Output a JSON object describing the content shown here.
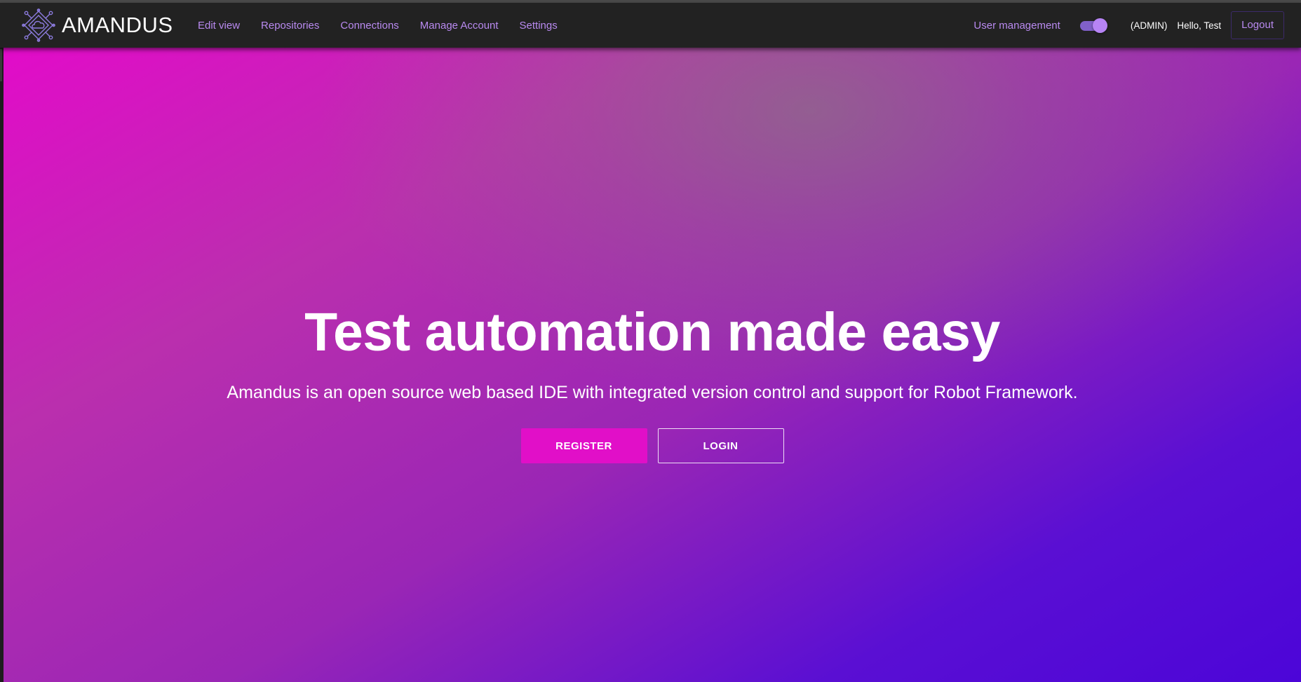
{
  "navbar": {
    "brand": "AMANDUS",
    "links": [
      "Edit view",
      "Repositories",
      "Connections",
      "Manage Account",
      "Settings"
    ],
    "user_management": "User management",
    "toggle_on": true,
    "role": "(ADMIN)",
    "greeting": "Hello, Test",
    "logout": "Logout"
  },
  "hero": {
    "title": "Test automation made easy",
    "subtitle": "Amandus is an open source web based IDE with integrated version control and support for Robot Framework.",
    "register_label": "REGISTER",
    "login_label": "LOGIN"
  },
  "colors": {
    "navbar_bg": "#222222",
    "link": "#b98af0",
    "accent": "#e10fc8",
    "gradient_start": "#e20bc9",
    "gradient_end": "#4c05d8"
  },
  "icons": {
    "logo": "circuit-cloud-icon",
    "toggle": "toggle-switch"
  }
}
